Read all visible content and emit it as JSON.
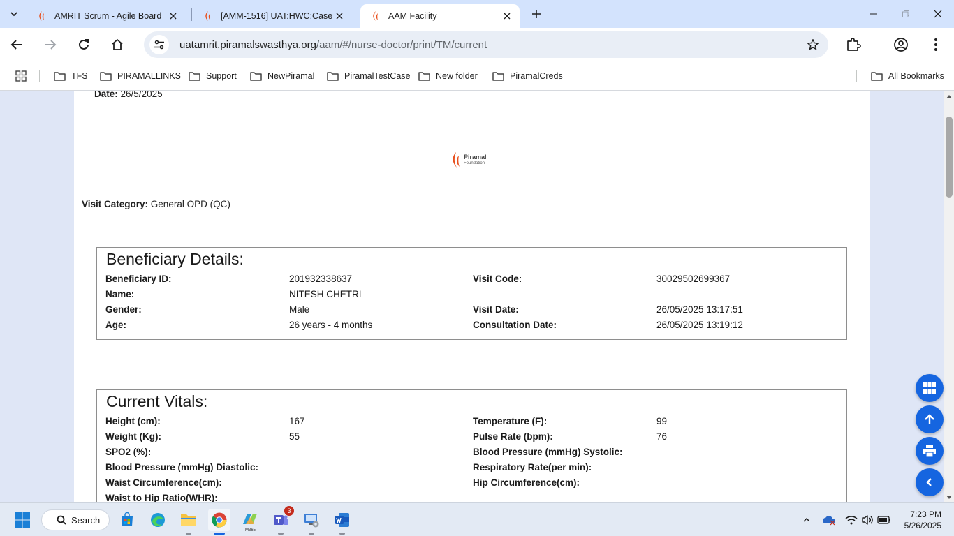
{
  "browser": {
    "tabs": [
      {
        "title": "AMRIT Scrum - Agile Board",
        "active": false
      },
      {
        "title": "[AMM-1516] UAT:HWC:Case",
        "active": false
      },
      {
        "title": "AAM Facility",
        "active": true
      }
    ],
    "url_host": "uatamrit.piramalswasthya.org",
    "url_path": "/aam/#/nurse-doctor/print/TM/current",
    "bookmarks": [
      "TFS",
      "PIRAMALLINKS",
      "Support",
      "NewPiramal",
      "PiramalTestCase",
      "New folder",
      "PiramalCreds"
    ],
    "all_bookmarks_label": "All Bookmarks"
  },
  "page": {
    "date_label": "Date:",
    "date_value": "26/5/2025",
    "logo_name": "Piramal",
    "logo_sub": "Foundation",
    "visit_category_label": "Visit Category:",
    "visit_category_value": "General OPD (QC)"
  },
  "beneficiary": {
    "heading": "Beneficiary Details:",
    "id_label": "Beneficiary ID:",
    "id_value": "201932338637",
    "visit_code_label": "Visit Code:",
    "visit_code_value": "30029502699367",
    "name_label": "Name:",
    "name_value": "NITESH CHETRI",
    "gender_label": "Gender:",
    "gender_value": "Male",
    "visit_date_label": "Visit Date:",
    "visit_date_value": "26/05/2025 13:17:51",
    "age_label": "Age:",
    "age_value": "26 years - 4 months",
    "consult_date_label": "Consultation Date:",
    "consult_date_value": "26/05/2025 13:19:12"
  },
  "vitals": {
    "heading": "Current Vitals:",
    "height_label": "Height (cm):",
    "height_value": "167",
    "temp_label": "Temperature (F):",
    "temp_value": "99",
    "weight_label": "Weight (Kg):",
    "weight_value": "55",
    "pulse_label": "Pulse Rate (bpm):",
    "pulse_value": "76",
    "spo2_label": "SPO2 (%):",
    "bp_sys_label": "Blood Pressure (mmHg) Systolic:",
    "bp_dia_label": "Blood Pressure (mmHg) Diastolic:",
    "resp_label": "Respiratory Rate(per min):",
    "waist_label": "Waist Circumference(cm):",
    "hip_label": "Hip Circumference(cm):",
    "whr_label": "Waist to Hip Ratio(WHR):"
  },
  "taskbar": {
    "search_label": "Search",
    "teams_badge": "3",
    "m365_label": "M365",
    "time": "7:23 PM",
    "date": "5/26/2025"
  },
  "colors": {
    "accent": "#1565e0",
    "tab_strip": "#d3e3fd",
    "page_background": "#dfe6f6",
    "piramal_orange": "#e8501e"
  }
}
